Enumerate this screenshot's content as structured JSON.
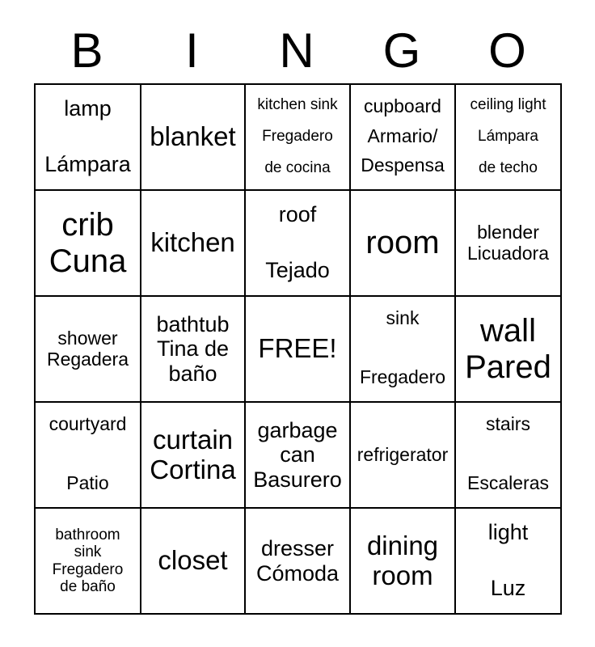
{
  "header": {
    "letters": [
      "B",
      "I",
      "N",
      "G",
      "O"
    ]
  },
  "grid": {
    "columns": 5,
    "rows": 5,
    "free_space_label": "FREE!",
    "cells": [
      {
        "id": "r1c1",
        "lines": [
          "lamp",
          "Lámpara"
        ],
        "size": "m",
        "layout": "spread-wide"
      },
      {
        "id": "r1c2",
        "lines": [
          "blanket"
        ],
        "size": "l",
        "layout": "center"
      },
      {
        "id": "r1c3",
        "lines": [
          "kitchen sink",
          "Fregadero",
          "de cocina"
        ],
        "size": "xs",
        "layout": "spread-wide"
      },
      {
        "id": "r1c4",
        "lines": [
          "cupboard",
          "Armario/",
          "Despensa"
        ],
        "size": "s",
        "layout": "spread-wide"
      },
      {
        "id": "r1c5",
        "lines": [
          "ceiling light",
          "Lámpara",
          "de techo"
        ],
        "size": "xs",
        "layout": "spread-wide"
      },
      {
        "id": "r2c1",
        "lines": [
          "crib",
          "Cuna"
        ],
        "size": "xl",
        "layout": "center"
      },
      {
        "id": "r2c2",
        "lines": [
          "kitchen"
        ],
        "size": "l",
        "layout": "center"
      },
      {
        "id": "r2c3",
        "lines": [
          "roof",
          "Tejado"
        ],
        "size": "m",
        "layout": "spread-wide"
      },
      {
        "id": "r2c4",
        "lines": [
          "room"
        ],
        "size": "xl",
        "layout": "center"
      },
      {
        "id": "r2c5",
        "lines": [
          "blender",
          "Licuadora"
        ],
        "size": "s",
        "layout": "center"
      },
      {
        "id": "r3c1",
        "lines": [
          "shower",
          "Regadera"
        ],
        "size": "s",
        "layout": "center"
      },
      {
        "id": "r3c2",
        "lines": [
          "bathtub",
          "Tina de",
          "baño"
        ],
        "size": "m",
        "layout": "center"
      },
      {
        "id": "r3c3",
        "lines": [
          "FREE!"
        ],
        "size": "l",
        "layout": "center"
      },
      {
        "id": "r3c4",
        "lines": [
          "sink",
          "Fregadero"
        ],
        "size": "s",
        "layout": "spread-wide"
      },
      {
        "id": "r3c5",
        "lines": [
          "wall",
          "Pared"
        ],
        "size": "xl",
        "layout": "center"
      },
      {
        "id": "r4c1",
        "lines": [
          "courtyard",
          "Patio"
        ],
        "size": "s",
        "layout": "spread-wide"
      },
      {
        "id": "r4c2",
        "lines": [
          "curtain",
          "Cortina"
        ],
        "size": "l",
        "layout": "center"
      },
      {
        "id": "r4c3",
        "lines": [
          "garbage",
          "can",
          "Basurero"
        ],
        "size": "m",
        "layout": "center"
      },
      {
        "id": "r4c4",
        "lines": [
          "refrigerator"
        ],
        "size": "s",
        "layout": "center"
      },
      {
        "id": "r4c5",
        "lines": [
          "stairs",
          "Escaleras"
        ],
        "size": "s",
        "layout": "spread-wide"
      },
      {
        "id": "r5c1",
        "lines": [
          "bathroom",
          "sink",
          "Fregadero",
          "de baño"
        ],
        "size": "xs",
        "layout": "center"
      },
      {
        "id": "r5c2",
        "lines": [
          "closet"
        ],
        "size": "l",
        "layout": "center"
      },
      {
        "id": "r5c3",
        "lines": [
          "dresser",
          "Cómoda"
        ],
        "size": "m",
        "layout": "center"
      },
      {
        "id": "r5c4",
        "lines": [
          "dining",
          "room"
        ],
        "size": "l",
        "layout": "center"
      },
      {
        "id": "r5c5",
        "lines": [
          "light",
          "Luz"
        ],
        "size": "m",
        "layout": "spread-wide"
      }
    ]
  },
  "style": {
    "background_color": "#ffffff",
    "text_color": "#000000",
    "border_color": "#000000"
  }
}
